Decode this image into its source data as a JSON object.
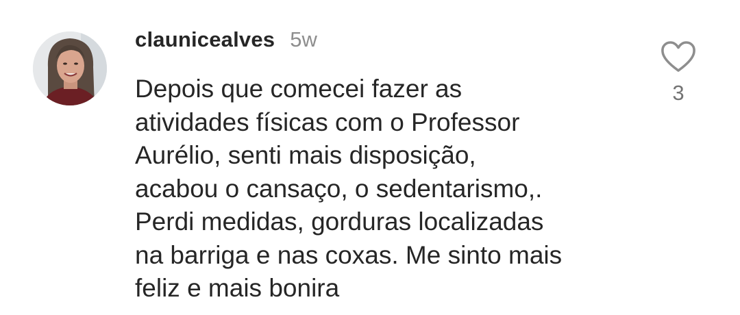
{
  "comment": {
    "username": "claunicealves",
    "timestamp": "5w",
    "text": "Depois que comecei fazer as\natividades físicas com o Professor\nAurélio,  senti mais disposição,\nacabou o cansaço,  o sedentarismo,.\nPerdi medidas, gorduras localizadas\nna barriga e nas coxas. Me sinto mais\nfeliz e mais bonira",
    "like_count": "3",
    "icons": {
      "avatar": "profile-photo",
      "like": "heart-outline-icon"
    },
    "colors": {
      "text": "#262626",
      "muted": "#8e8e8e",
      "icon": "#8e8e8e"
    }
  }
}
